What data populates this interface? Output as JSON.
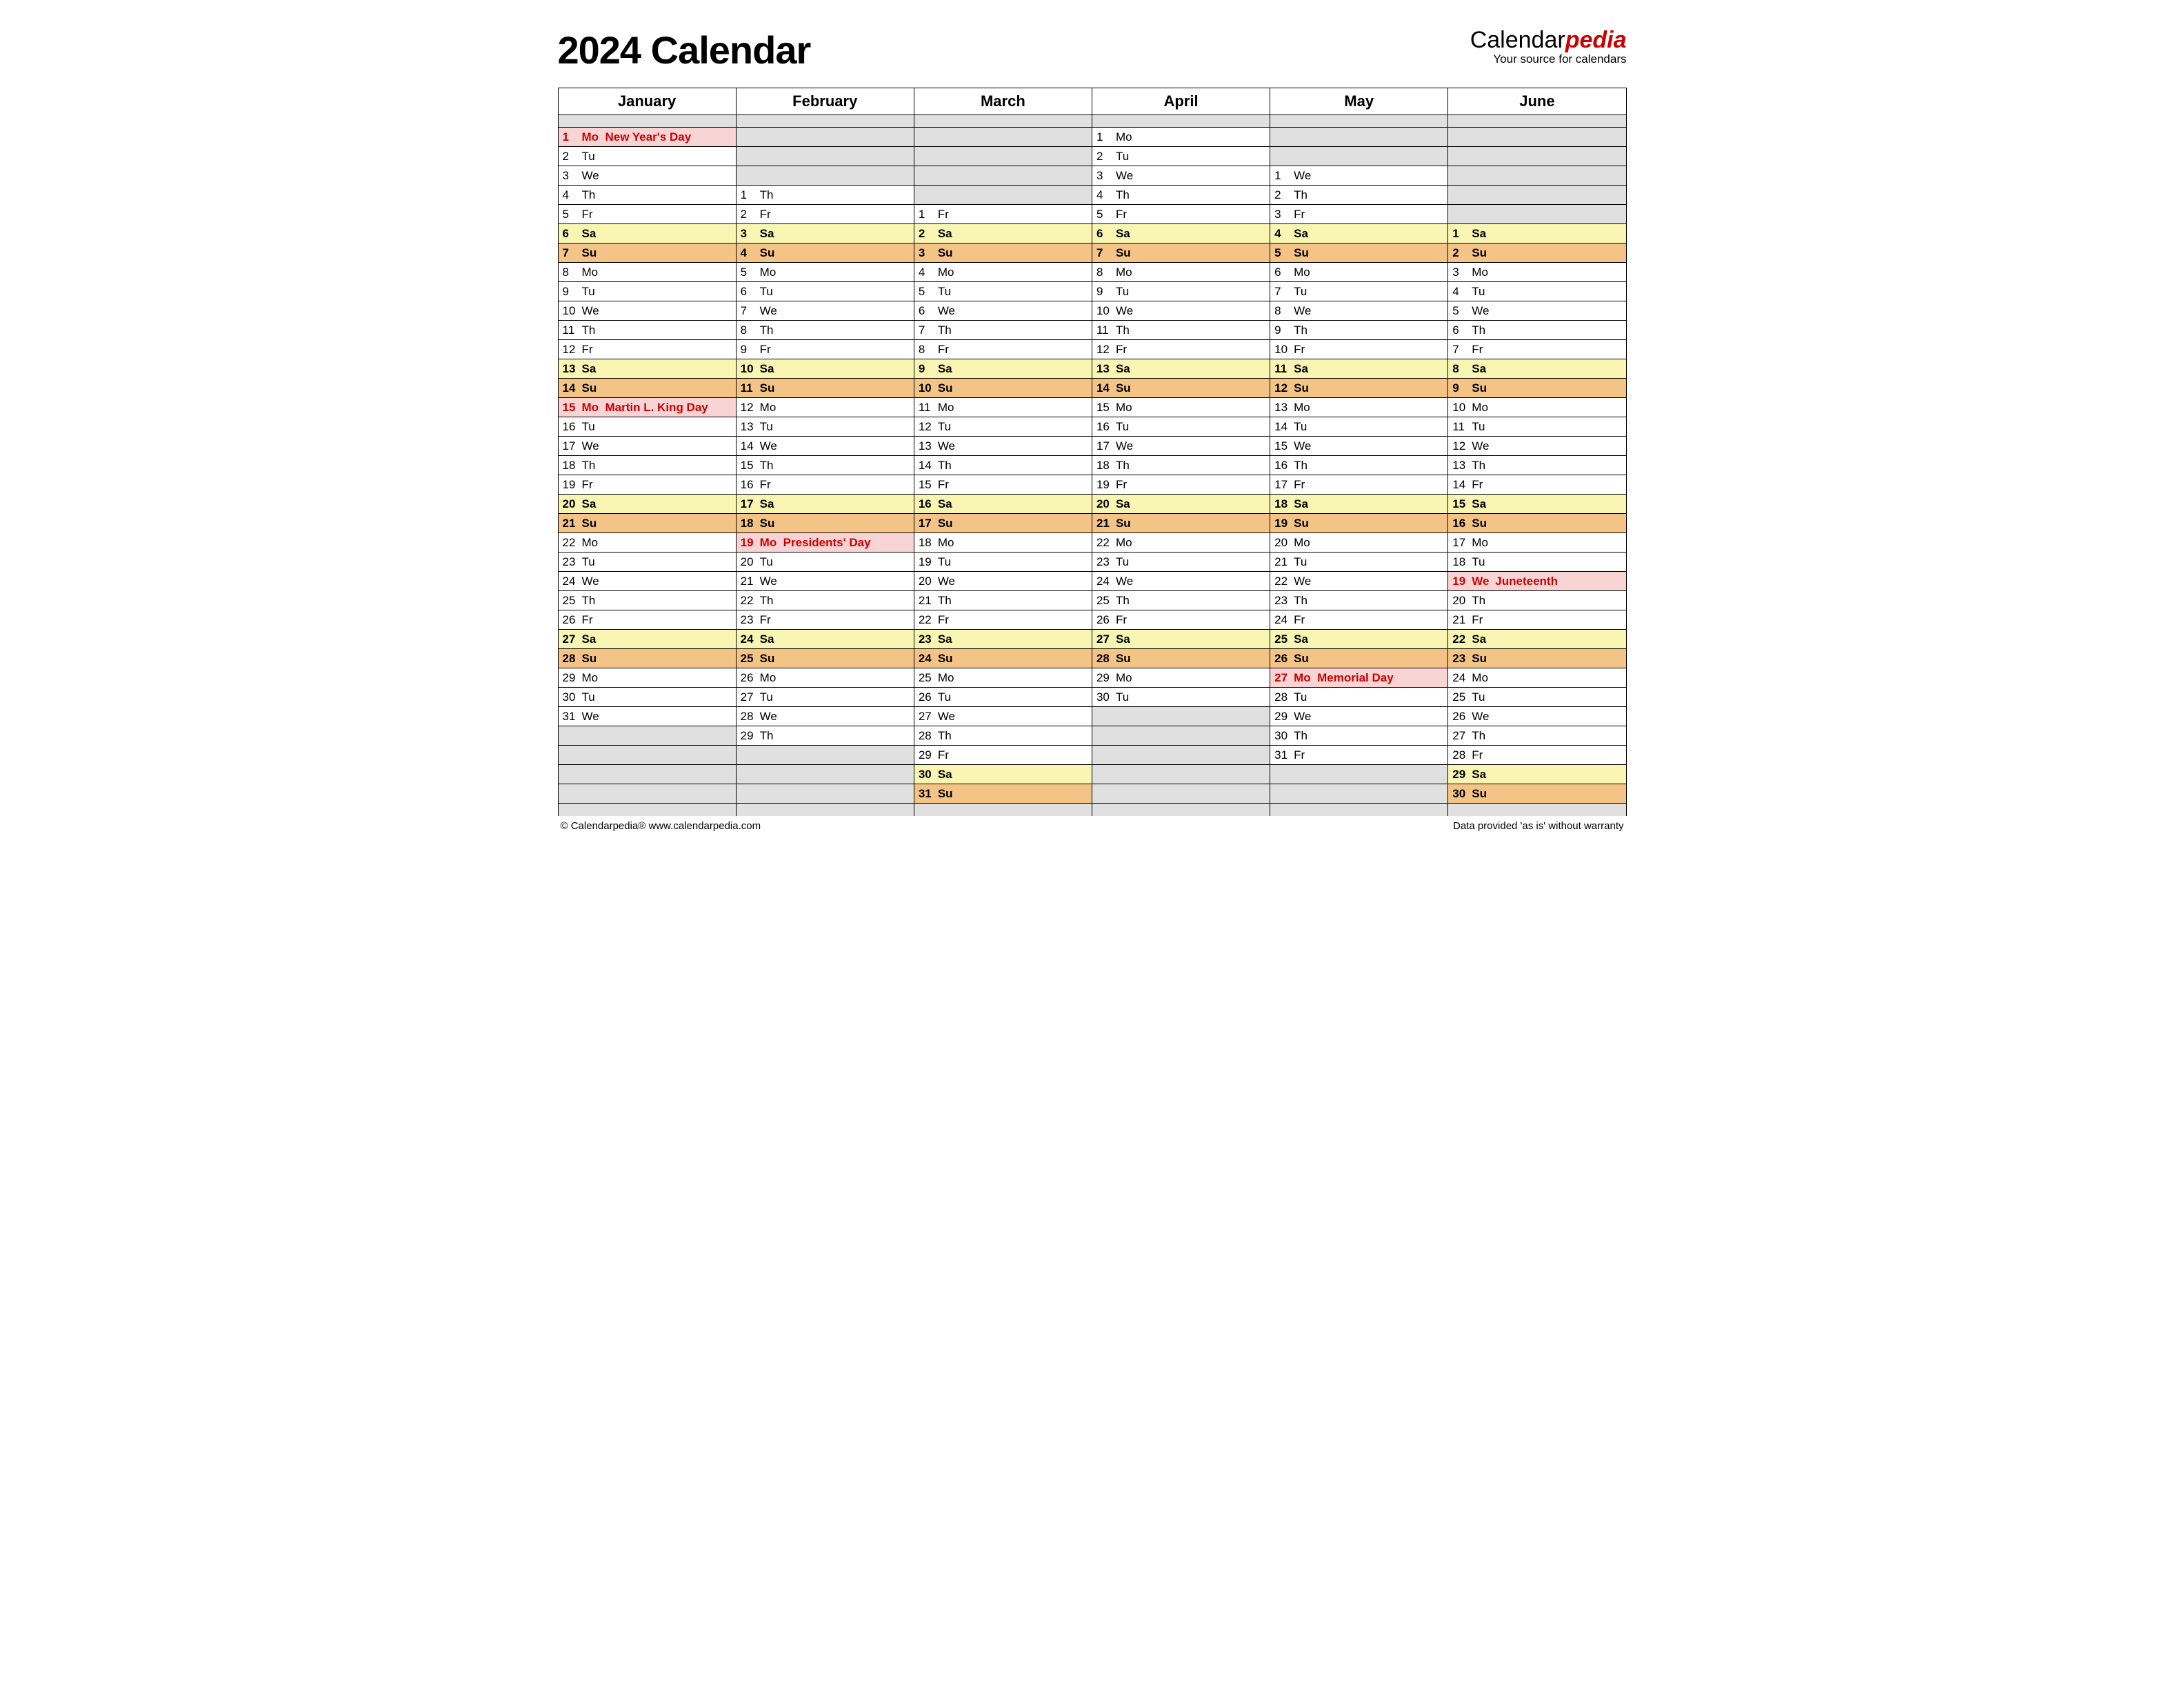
{
  "title": "2024 Calendar",
  "brand": {
    "part1": "Calendar",
    "part2": "pedia",
    "tagline": "Your source for calendars"
  },
  "footer": {
    "left": "© Calendarpedia®   www.calendarpedia.com",
    "right": "Data provided 'as is' without warranty"
  },
  "dow_labels": [
    "Mo",
    "Tu",
    "We",
    "Th",
    "Fr",
    "Sa",
    "Su"
  ],
  "months": [
    {
      "name": "January",
      "offset": 0,
      "ndays": 31,
      "holidays": {
        "1": "New Year's Day",
        "15": "Martin L. King Day"
      }
    },
    {
      "name": "February",
      "offset": 3,
      "ndays": 29,
      "holidays": {
        "19": "Presidents' Day"
      }
    },
    {
      "name": "March",
      "offset": 4,
      "ndays": 31,
      "holidays": {}
    },
    {
      "name": "April",
      "offset": 0,
      "ndays": 30,
      "holidays": {}
    },
    {
      "name": "May",
      "offset": 2,
      "ndays": 31,
      "holidays": {
        "27": "Memorial Day"
      }
    },
    {
      "name": "June",
      "offset": 5,
      "ndays": 30,
      "holidays": {
        "19": "Juneteenth"
      }
    }
  ],
  "rows": 35
}
